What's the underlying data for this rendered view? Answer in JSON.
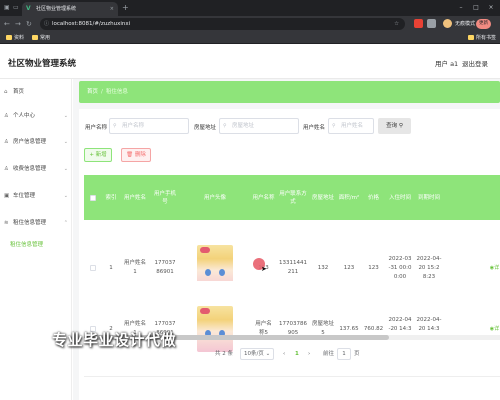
{
  "browser": {
    "tab_title": "社区物业管理系统",
    "url": "localhost:8081/#/zuzhuxinxi",
    "incognito_label": "无痕模式",
    "update_label": "更新",
    "bookmarks": [
      "资料",
      "常用"
    ],
    "bookmarks_right": "所有书签"
  },
  "header": {
    "app_title": "社区物业管理系统",
    "user": "用户 a1",
    "logout": "退出登录"
  },
  "sidebar": {
    "items": [
      {
        "label": "首页",
        "icon": "home-icon"
      },
      {
        "label": "个人中心",
        "icon": "person-icon"
      },
      {
        "label": "房户信息管理",
        "icon": "person-icon"
      },
      {
        "label": "收费信息管理",
        "icon": "person-icon"
      },
      {
        "label": "车位管理",
        "icon": "car-icon"
      },
      {
        "label": "租住信息管理",
        "icon": "stack-icon"
      }
    ],
    "active_sub": "租住信息管理"
  },
  "breadcrumb": {
    "home": "首页",
    "current": "租住信息"
  },
  "filters": {
    "account_label": "用户名称",
    "account_placeholder": "用户名称",
    "house_label": "房屋地址",
    "house_placeholder": "房屋地址",
    "name_label": "用户姓名",
    "name_placeholder": "用户姓名",
    "search_label": "查询"
  },
  "actions": {
    "add": "+ 新增",
    "delete": "删除"
  },
  "table": {
    "columns": [
      "",
      "索引",
      "用户姓名",
      "用户手机号",
      "用户头像",
      "用户名称",
      "用户联系方式",
      "房屋地址",
      "面积/m²",
      "价格",
      "入住时间",
      "到期时间",
      ""
    ],
    "rows": [
      {
        "index": "1",
        "user_name": "用户姓名1",
        "phone": "17703786901",
        "account": "123",
        "contact": "13311441211",
        "address": "132",
        "area": "123",
        "price": "123",
        "checkin": "2022-03-31 00:00:00",
        "expire": "2022-04-20 15:28:23",
        "action": "详"
      },
      {
        "index": "2",
        "user_name": "用户姓名1",
        "phone": "17703786901",
        "account": "用户名称5",
        "contact": "17703786905",
        "address": "房屋地址5",
        "area": "137.65",
        "price": "760.82",
        "checkin": "2022-04-20 14:39:27",
        "expire": "2022-04-20 14:39:27",
        "action": "详"
      }
    ]
  },
  "pager": {
    "total": "共 2 条",
    "page_size": "10条/页",
    "prev": "‹",
    "current": "1",
    "next": "›",
    "goto": "前往",
    "goto_value": "1",
    "page_unit": "页"
  },
  "watermark": "专业毕业设计代做",
  "colors": {
    "accent": "#8ee47a",
    "accent_text": "#67c23a",
    "danger": "#f56c6c"
  }
}
